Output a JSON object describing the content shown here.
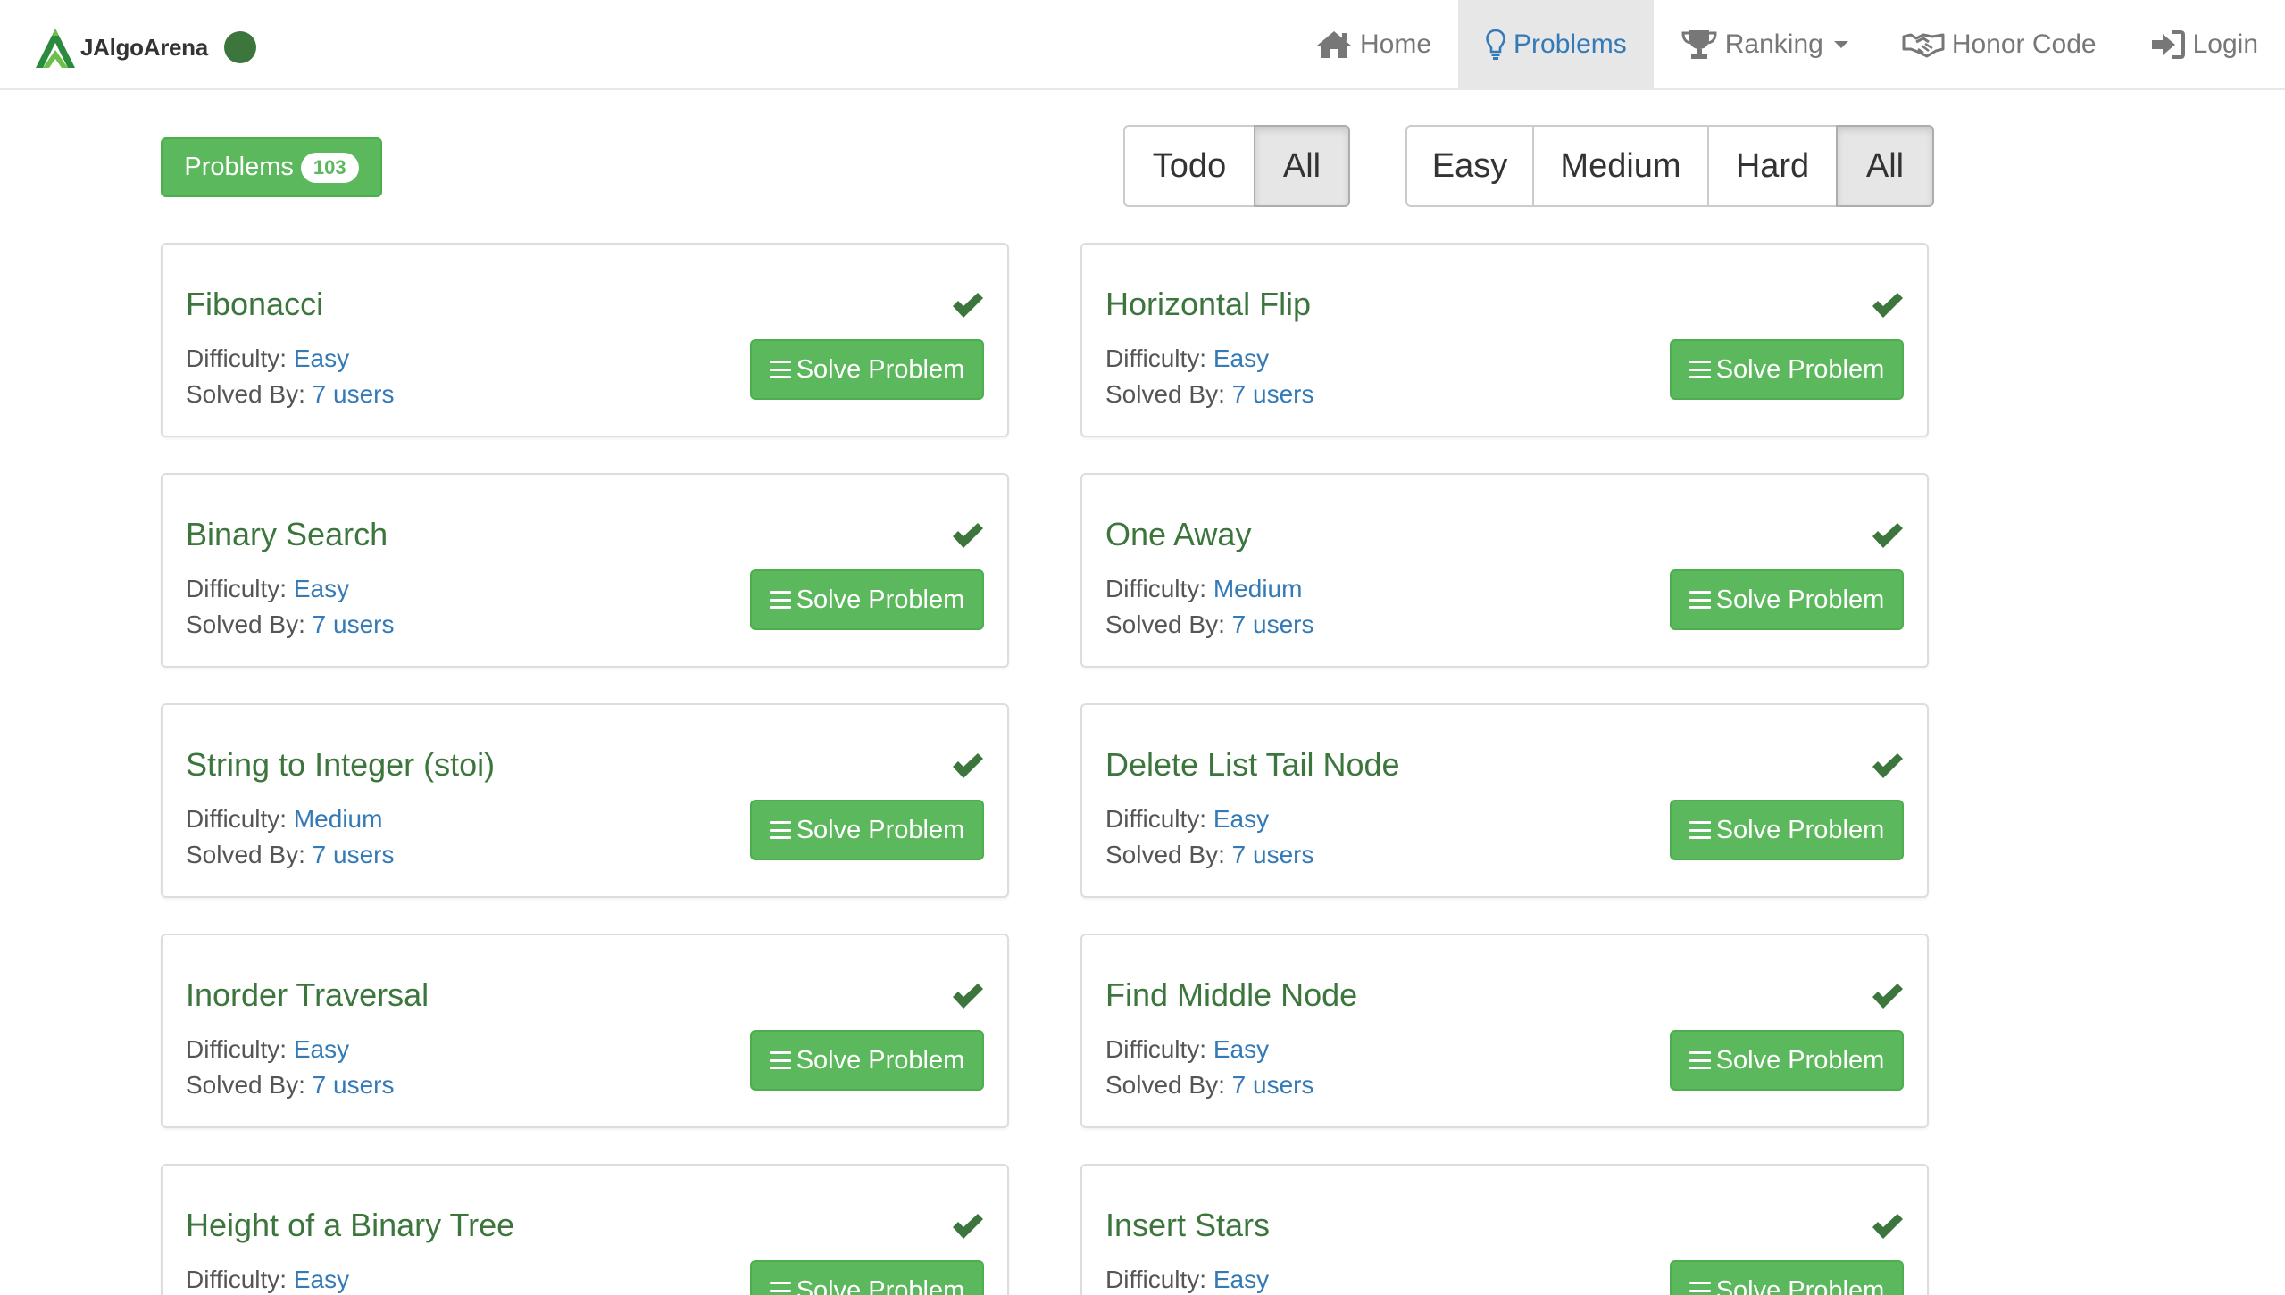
{
  "brand": {
    "name": "JAlgoArena",
    "status_color": "#3c763d"
  },
  "nav": {
    "items": [
      {
        "label": "Home",
        "icon": "home-icon"
      },
      {
        "label": "Problems",
        "icon": "lightbulb-icon",
        "active": true
      },
      {
        "label": "Ranking",
        "icon": "trophy-icon",
        "dropdown": true
      },
      {
        "label": "Honor Code",
        "icon": "handshake-icon"
      },
      {
        "label": "Login",
        "icon": "sign-in-icon"
      }
    ]
  },
  "toolbar": {
    "problems_label": "Problems",
    "problems_count": "103",
    "status_filter": [
      {
        "label": "Todo",
        "active": false
      },
      {
        "label": "All",
        "active": true
      }
    ],
    "difficulty_filter": [
      {
        "label": "Easy",
        "active": false
      },
      {
        "label": "Medium",
        "active": false
      },
      {
        "label": "Hard",
        "active": false
      },
      {
        "label": "All",
        "active": true
      }
    ]
  },
  "labels": {
    "difficulty": "Difficulty:",
    "solved_by": "Solved By:",
    "solve_button": "Solve Problem"
  },
  "problems": [
    {
      "title": "Fibonacci",
      "difficulty": "Easy",
      "solved_by": "7 users",
      "solved": true
    },
    {
      "title": "Horizontal Flip",
      "difficulty": "Easy",
      "solved_by": "7 users",
      "solved": true
    },
    {
      "title": "Binary Search",
      "difficulty": "Easy",
      "solved_by": "7 users",
      "solved": true
    },
    {
      "title": "One Away",
      "difficulty": "Medium",
      "solved_by": "7 users",
      "solved": true
    },
    {
      "title": "String to Integer (stoi)",
      "difficulty": "Medium",
      "solved_by": "7 users",
      "solved": true
    },
    {
      "title": "Delete List Tail Node",
      "difficulty": "Easy",
      "solved_by": "7 users",
      "solved": true
    },
    {
      "title": "Inorder Traversal",
      "difficulty": "Easy",
      "solved_by": "7 users",
      "solved": true
    },
    {
      "title": "Find Middle Node",
      "difficulty": "Easy",
      "solved_by": "7 users",
      "solved": true
    },
    {
      "title": "Height of a Binary Tree",
      "difficulty": "Easy",
      "solved_by": "",
      "solved": true
    },
    {
      "title": "Insert Stars",
      "difficulty": "Easy",
      "solved_by": "",
      "solved": true
    }
  ],
  "colors": {
    "success": "#5cb85c",
    "title_green": "#3c763d",
    "link_blue": "#337ab7"
  }
}
